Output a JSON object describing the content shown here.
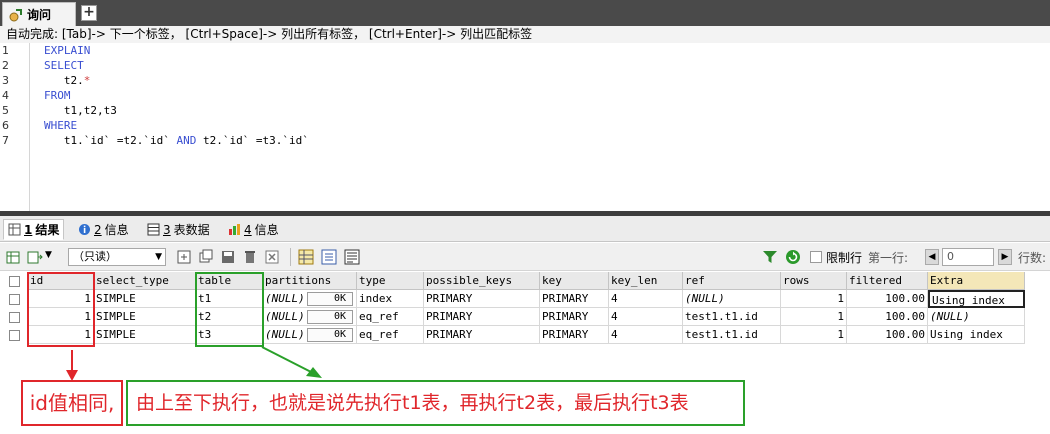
{
  "tabbar": {
    "query_tab_label": "询问",
    "add_tab_label": "+"
  },
  "hint": {
    "text": "自动完成: [Tab]-> 下一个标签， [Ctrl+Space]-> 列出所有标签， [Ctrl+Enter]-> 列出匹配标签"
  },
  "editor": {
    "line_numbers": [
      "1",
      "2",
      "3",
      "4",
      "5",
      "6",
      "7"
    ],
    "lines": [
      {
        "kw": "EXPLAIN",
        "text": ""
      },
      {
        "kw": "SELECT",
        "text": ""
      },
      {
        "kw": "",
        "text": "   t2.",
        "red": "*"
      },
      {
        "kw": "FROM",
        "text": ""
      },
      {
        "kw": "",
        "text": "   t1,t2,t3"
      },
      {
        "kw": "WHERE",
        "text": ""
      },
      {
        "kw": "",
        "text": "   t1.`id` =t2.`id` ",
        "kw2": "AND",
        "text2": " t2.`id` =t3.`id`"
      }
    ]
  },
  "result_tabs": [
    {
      "num": "1",
      "label": "结果"
    },
    {
      "num": "2",
      "label": "信息"
    },
    {
      "num": "3",
      "label": "表数据"
    },
    {
      "num": "4",
      "label": "信息"
    }
  ],
  "toolbar": {
    "readonly_value": "（只读）",
    "limit_label": "限制行",
    "first_row_label": "第一行:",
    "first_row_value": "0",
    "rows_label": "行数:"
  },
  "grid": {
    "columns": [
      "id",
      "select_type",
      "table",
      "partitions",
      "type",
      "possible_keys",
      "key",
      "key_len",
      "ref",
      "rows",
      "filtered",
      "Extra"
    ],
    "rows": [
      {
        "id": "1",
        "select_type": "SIMPLE",
        "table": "t1",
        "partitions": "(NULL)",
        "ok": "0K",
        "type": "index",
        "possible_keys": "PRIMARY",
        "key": "PRIMARY",
        "key_len": "4",
        "ref": "(NULL)",
        "rows": "1",
        "filtered": "100.00",
        "Extra": "Using index"
      },
      {
        "id": "1",
        "select_type": "SIMPLE",
        "table": "t2",
        "partitions": "(NULL)",
        "ok": "0K",
        "type": "eq_ref",
        "possible_keys": "PRIMARY",
        "key": "PRIMARY",
        "key_len": "4",
        "ref": "test1.t1.id",
        "rows": "1",
        "filtered": "100.00",
        "Extra": "(NULL)"
      },
      {
        "id": "1",
        "select_type": "SIMPLE",
        "table": "t3",
        "partitions": "(NULL)",
        "ok": "0K",
        "type": "eq_ref",
        "possible_keys": "PRIMARY",
        "key": "PRIMARY",
        "key_len": "4",
        "ref": "test1.t1.id",
        "rows": "1",
        "filtered": "100.00",
        "Extra": "Using index"
      }
    ]
  },
  "annotations": {
    "red_text": "id值相同,",
    "green_text": "由上至下执行，也就是说先执行t1表，再执行t2表，最后执行t3表",
    "red_color": "#e0262b",
    "green_color": "#2aa02a"
  },
  "colors": {
    "keyword": "#3a4fd1",
    "tabbar_bg": "#4a4a4a"
  }
}
